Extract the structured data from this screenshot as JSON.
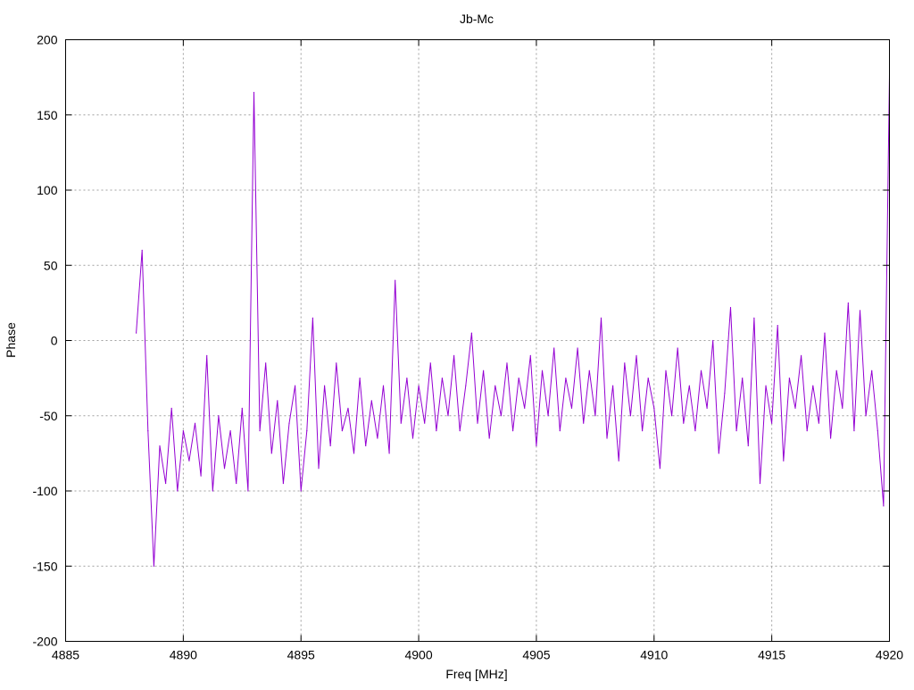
{
  "chart_data": {
    "type": "line",
    "title": "Jb-Mc",
    "xlabel": "Freq [MHz]",
    "ylabel": "Phase",
    "xlim": [
      4885,
      4920
    ],
    "ylim": [
      -200,
      200
    ],
    "xticks": [
      4885,
      4890,
      4895,
      4900,
      4905,
      4910,
      4915,
      4920
    ],
    "yticks": [
      200,
      150,
      100,
      50,
      0,
      -50,
      -100,
      -150,
      -200
    ],
    "grid": true,
    "series": [
      {
        "name": "Jb-Mc phase",
        "color": "#9400d3",
        "x_start": 4888.0,
        "x_step": 0.25,
        "values": [
          5,
          60,
          -60,
          -150,
          -70,
          -95,
          -45,
          -100,
          -60,
          -80,
          -55,
          -90,
          -10,
          -100,
          -50,
          -85,
          -60,
          -95,
          -45,
          -100,
          165,
          -60,
          -15,
          -75,
          -40,
          -95,
          -55,
          -30,
          -100,
          -60,
          15,
          -85,
          -30,
          -70,
          -15,
          -60,
          -45,
          -75,
          -25,
          -70,
          -40,
          -65,
          -30,
          -75,
          40,
          -55,
          -25,
          -65,
          -30,
          -55,
          -15,
          -60,
          -25,
          -50,
          -10,
          -60,
          -30,
          5,
          -55,
          -20,
          -65,
          -30,
          -50,
          -15,
          -60,
          -25,
          -45,
          -10,
          -70,
          -20,
          -50,
          -5,
          -60,
          -25,
          -45,
          -5,
          -55,
          -20,
          -50,
          15,
          -65,
          -30,
          -80,
          -15,
          -50,
          -10,
          -60,
          -25,
          -45,
          -85,
          -20,
          -50,
          -5,
          -55,
          -30,
          -60,
          -20,
          -45,
          0,
          -75,
          -35,
          22,
          -60,
          -25,
          -70,
          15,
          -95,
          -30,
          -55,
          10,
          -80,
          -25,
          -45,
          -10,
          -60,
          -30,
          -55,
          5,
          -65,
          -20,
          -45,
          25,
          -60,
          20,
          -50,
          -20,
          -60,
          -110,
          176
        ]
      }
    ]
  }
}
